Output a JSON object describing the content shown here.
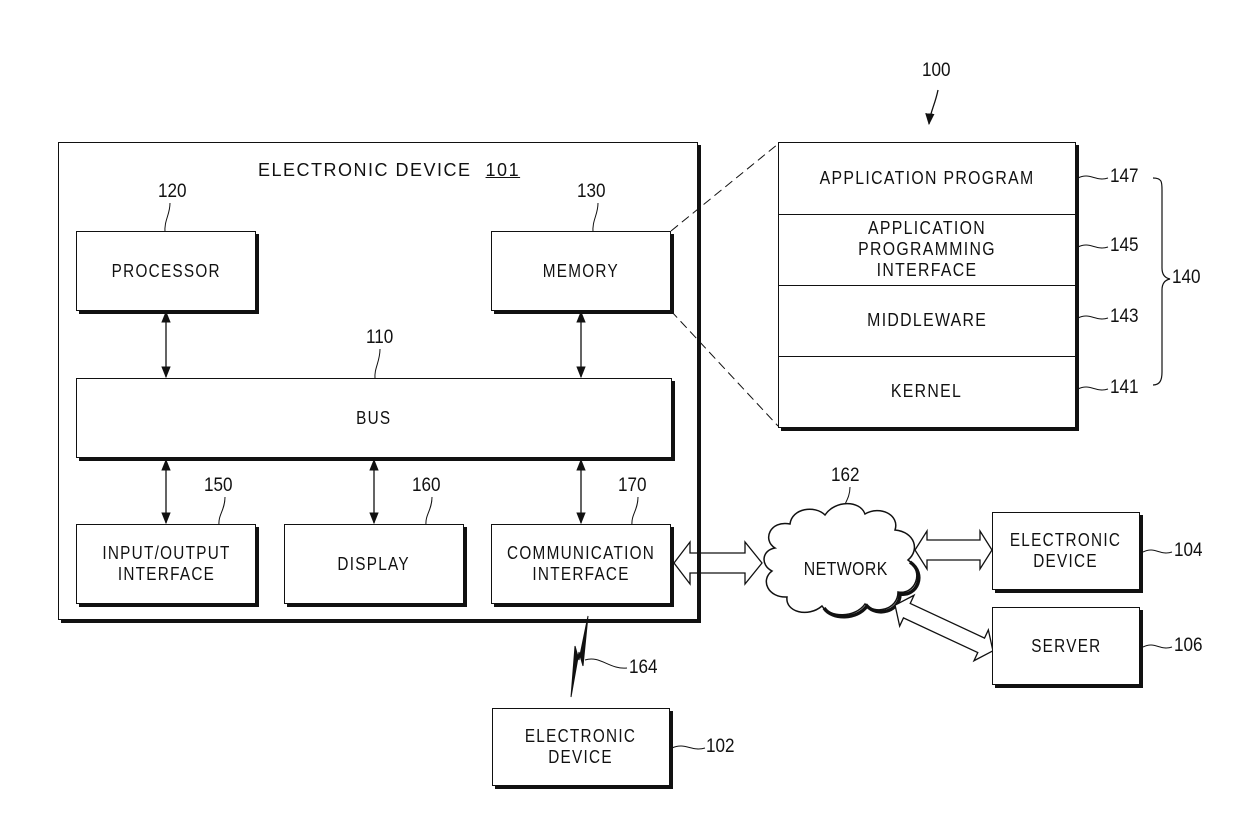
{
  "figure": {
    "system_ref": "100",
    "device": {
      "title": "ELECTRONIC DEVICE",
      "ref": "101"
    },
    "components": {
      "processor": {
        "label": "PROCESSOR",
        "ref": "120"
      },
      "memory": {
        "label": "MEMORY",
        "ref": "130"
      },
      "bus": {
        "label": "BUS",
        "ref": "110"
      },
      "io_interface": {
        "label": "INPUT/OUTPUT\nINTERFACE",
        "ref": "150"
      },
      "display": {
        "label": "DISPLAY",
        "ref": "160"
      },
      "comm_interface": {
        "label": "COMMUNICATION\nINTERFACE",
        "ref": "170"
      }
    },
    "program_stack": {
      "ref": "140",
      "layers": [
        {
          "label": "APPLICATION PROGRAM",
          "ref": "147"
        },
        {
          "label": "APPLICATION PROGRAMMING\nINTERFACE",
          "ref": "145"
        },
        {
          "label": "MIDDLEWARE",
          "ref": "143"
        },
        {
          "label": "KERNEL",
          "ref": "141"
        }
      ]
    },
    "network": {
      "label": "NETWORK",
      "ref": "162"
    },
    "wireless_link": {
      "ref": "164"
    },
    "external": {
      "device_104": {
        "label": "ELECTRONIC\nDEVICE",
        "ref": "104"
      },
      "server": {
        "label": "SERVER",
        "ref": "106"
      },
      "device_102": {
        "label": "ELECTRONIC\nDEVICE",
        "ref": "102"
      }
    }
  }
}
